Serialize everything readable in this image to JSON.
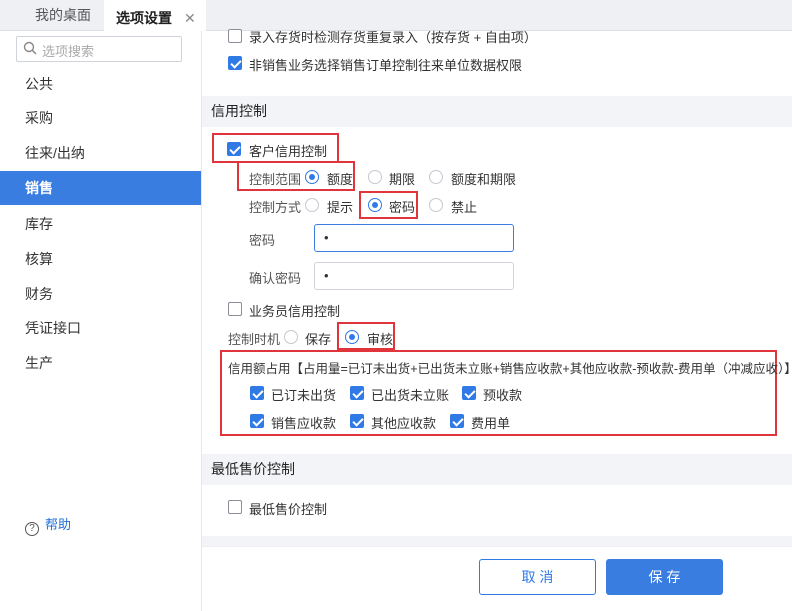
{
  "tabs": {
    "home": "我的桌面",
    "active": "选项设置",
    "close_glyph": "✕"
  },
  "sidebar": {
    "search_placeholder": "选项搜索",
    "items": [
      {
        "label": "公共"
      },
      {
        "label": "采购"
      },
      {
        "label": "往来/出纳"
      },
      {
        "label": "销售",
        "active": true
      },
      {
        "label": "库存"
      },
      {
        "label": "核算"
      },
      {
        "label": "财务"
      },
      {
        "label": "凭证接口"
      },
      {
        "label": "生产"
      }
    ],
    "help": "帮助"
  },
  "top_options": {
    "opt1": {
      "label": "录入存货时检测存货重复录入（按存货 + 自由项）",
      "checked": false
    },
    "opt2": {
      "label": "非销售业务选择销售订单控制往来单位数据权限",
      "checked": true
    }
  },
  "credit": {
    "title": "信用控制",
    "customer_credit": {
      "label": "客户信用控制",
      "checked": true
    },
    "scope": {
      "label": "控制范围",
      "options": [
        "额度",
        "期限",
        "额度和期限"
      ],
      "selected": "额度"
    },
    "method": {
      "label": "控制方式",
      "options": [
        "提示",
        "密码",
        "禁止"
      ],
      "selected": "密码"
    },
    "password": {
      "label": "密码",
      "value": "•"
    },
    "confirm_password": {
      "label": "确认密码",
      "value": "•"
    },
    "salesman_credit": {
      "label": "业务员信用控制",
      "checked": false
    },
    "timing": {
      "label": "控制时机",
      "options": [
        "保存",
        "审核"
      ],
      "selected": "审核"
    },
    "occupation": {
      "label": "信用额占用【占用量=已订未出货+已出货未立账+销售应收款+其他应收款-预收款-费用单（冲减应收）】",
      "items": [
        {
          "label": "已订未出货",
          "checked": true
        },
        {
          "label": "已出货未立账",
          "checked": true
        },
        {
          "label": "预收款",
          "checked": true
        },
        {
          "label": "销售应收款",
          "checked": true
        },
        {
          "label": "其他应收款",
          "checked": true
        },
        {
          "label": "费用单",
          "checked": true
        }
      ]
    }
  },
  "min_price": {
    "title": "最低售价控制",
    "option": {
      "label": "最低售价控制",
      "checked": false
    }
  },
  "footer": {
    "cancel": "取 消",
    "save": "保 存"
  },
  "colors": {
    "accent": "#3a7de0",
    "highlight_box": "#e0353b"
  }
}
